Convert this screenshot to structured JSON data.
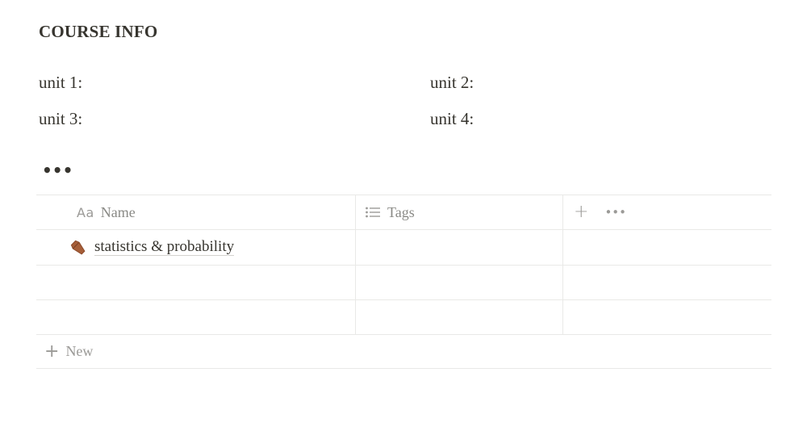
{
  "heading": "COURSE INFO",
  "units": {
    "unit1": "unit 1:",
    "unit2": "unit 2:",
    "unit3": "unit 3:",
    "unit4": "unit 4:"
  },
  "toolbar": {
    "more_label": "•••"
  },
  "table": {
    "columns": {
      "name": {
        "label": "Name",
        "icon": "Aa"
      },
      "tags": {
        "label": "Tags",
        "icon": "list-icon"
      },
      "add": {
        "plus": "+",
        "more": "•••"
      }
    },
    "rows": [
      {
        "name": "statistics & probability",
        "icon": "coffin-icon",
        "tags": ""
      },
      {
        "name": "",
        "tags": ""
      },
      {
        "name": "",
        "tags": ""
      }
    ],
    "new_row": {
      "plus": "+",
      "label": "New"
    }
  }
}
